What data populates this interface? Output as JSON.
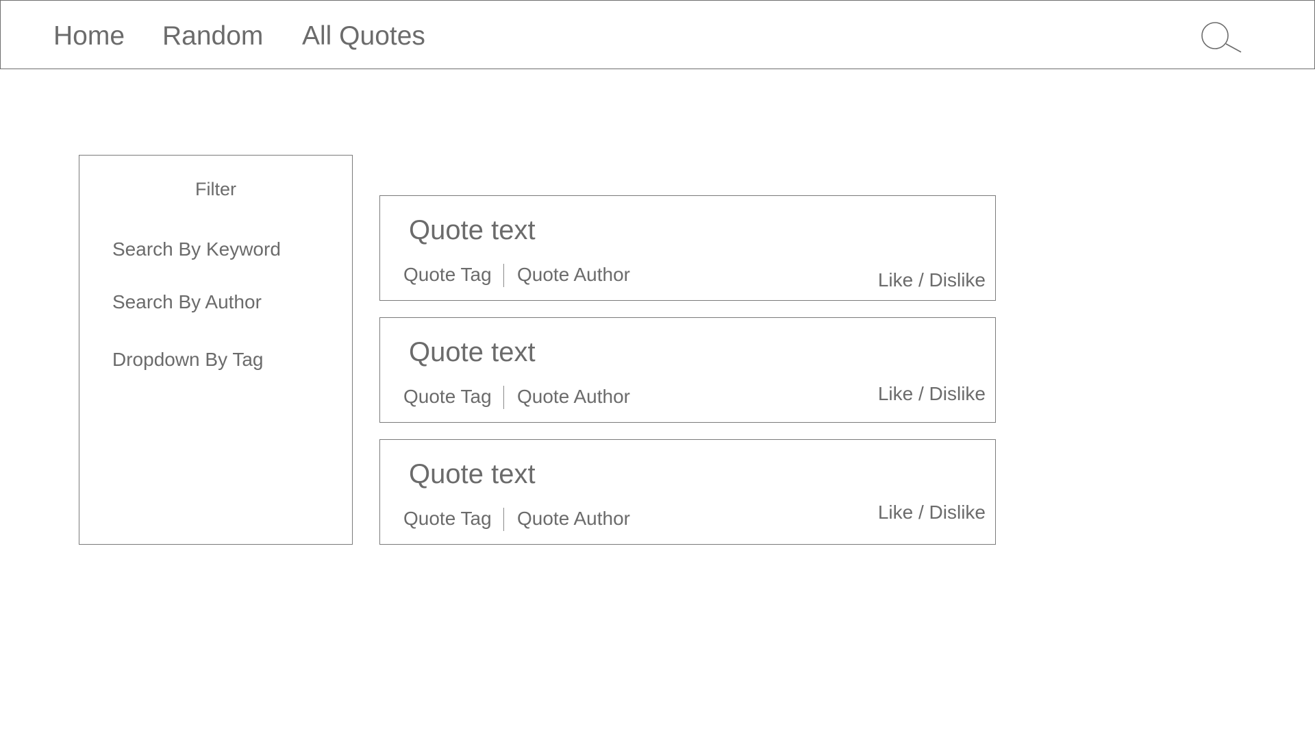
{
  "nav": {
    "links": [
      {
        "label": "Home"
      },
      {
        "label": "Random"
      },
      {
        "label": "All Quotes"
      }
    ],
    "search_icon": "search-icon"
  },
  "filter": {
    "title": "Filter",
    "options": [
      {
        "label": "Search By Keyword"
      },
      {
        "label": "Search By Author"
      },
      {
        "label": "Dropdown By Tag"
      }
    ]
  },
  "quotes": [
    {
      "text": "Quote text",
      "tag": "Quote Tag",
      "author": "Quote Author",
      "action": "Like / Dislike"
    },
    {
      "text": "Quote text",
      "tag": "Quote Tag",
      "author": "Quote Author",
      "action": "Like / Dislike"
    },
    {
      "text": "Quote text",
      "tag": "Quote Tag",
      "author": "Quote Author",
      "action": "Like / Dislike"
    }
  ],
  "colors": {
    "text": "#6b6b6b",
    "border": "#7a7a7a",
    "background": "#ffffff"
  }
}
